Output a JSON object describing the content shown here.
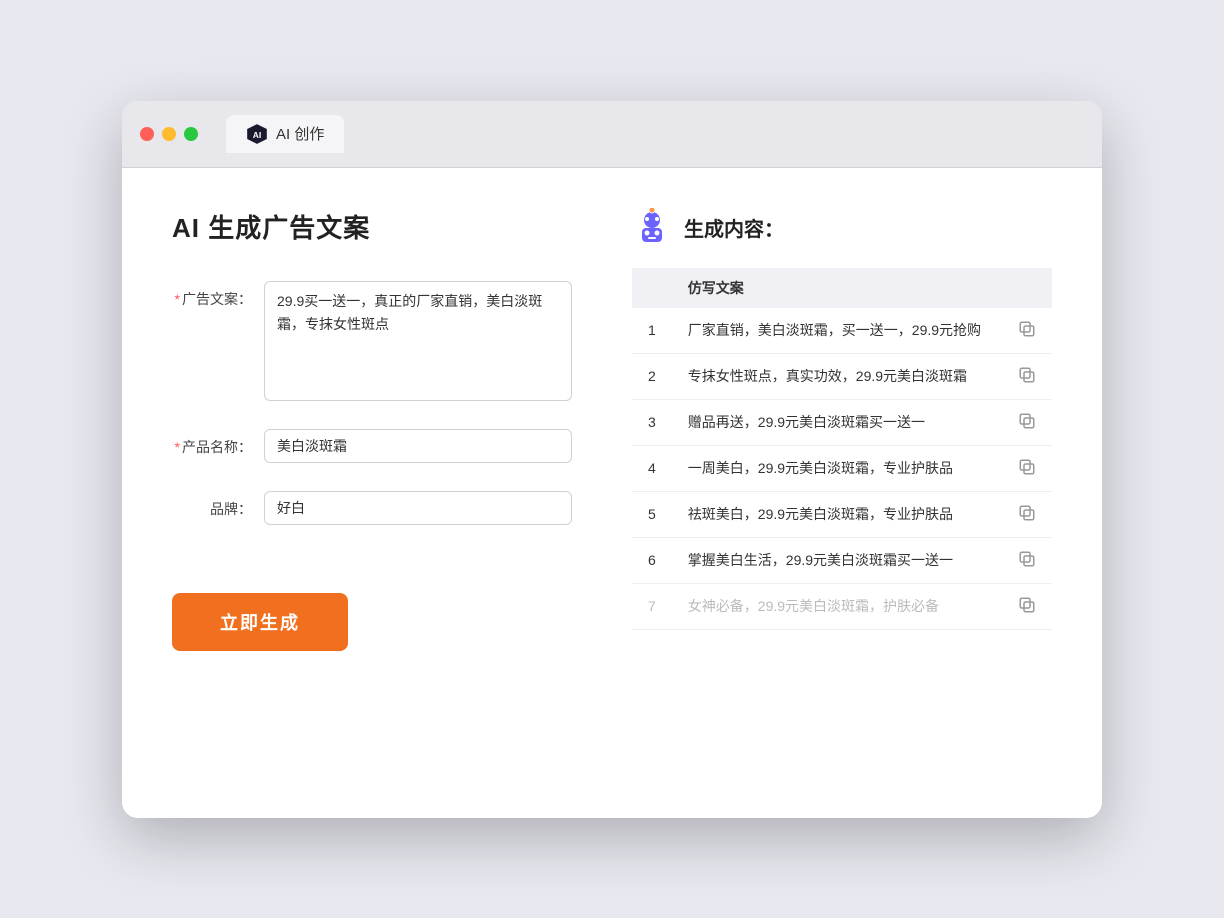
{
  "browser": {
    "tab_label": "AI 创作"
  },
  "page": {
    "title": "AI 生成广告文案",
    "result_title": "生成内容："
  },
  "form": {
    "ad_copy_label": "广告文案：",
    "ad_copy_value": "29.9买一送一，真正的厂家直销，美白淡斑霜，专抹女性斑点",
    "product_name_label": "产品名称：",
    "product_name_value": "美白淡斑霜",
    "brand_label": "品牌：",
    "brand_value": "好白",
    "generate_button": "立即生成"
  },
  "results": {
    "column_header": "仿写文案",
    "items": [
      {
        "id": 1,
        "text": "厂家直销，美白淡斑霜，买一送一，29.9元抢购"
      },
      {
        "id": 2,
        "text": "专抹女性斑点，真实功效，29.9元美白淡斑霜"
      },
      {
        "id": 3,
        "text": "赠品再送，29.9元美白淡斑霜买一送一"
      },
      {
        "id": 4,
        "text": "一周美白，29.9元美白淡斑霜，专业护肤品"
      },
      {
        "id": 5,
        "text": "祛斑美白，29.9元美白淡斑霜，专业护肤品"
      },
      {
        "id": 6,
        "text": "掌握美白生活，29.9元美白淡斑霜买一送一"
      },
      {
        "id": 7,
        "text": "女神必备，29.9元美白淡斑霜，护肤必备"
      }
    ]
  }
}
